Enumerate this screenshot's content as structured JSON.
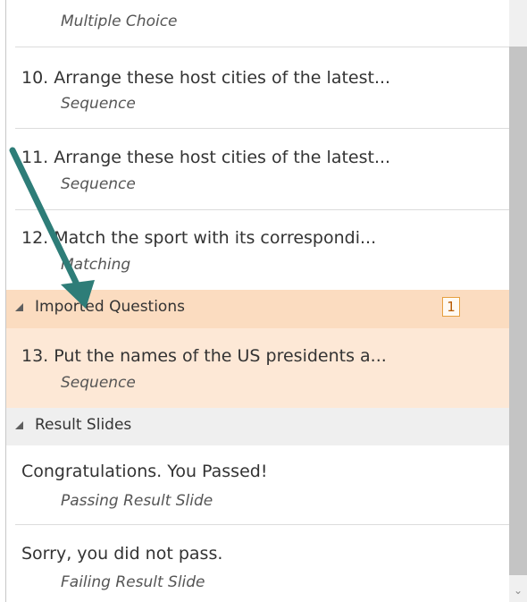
{
  "items_top": {
    "subtitle": "Multiple Choice"
  },
  "questions": [
    {
      "title": "10. Arrange these host cities of the latest...",
      "type": "Sequence"
    },
    {
      "title": "11. Arrange these host cities of the latest...",
      "type": "Sequence"
    },
    {
      "title": "12.  Match the sport with its correspondi...",
      "type": "Matching"
    }
  ],
  "imported_group": {
    "label": "Imported Questions",
    "count": "1",
    "items": [
      {
        "title": "13. Put the names of the US presidents a...",
        "type": "Sequence"
      }
    ]
  },
  "result_group": {
    "label": "Result Slides",
    "items": [
      {
        "title": "Congratulations. You Passed!",
        "type": "Passing Result Slide"
      },
      {
        "title": "Sorry, you did not pass.",
        "type": "Failing Result Slide"
      }
    ]
  },
  "colors": {
    "imported_bg": "#fbdcc0",
    "selected_bg": "#fde8d6",
    "result_header_bg": "#efefef",
    "arrow": "#2e7d78"
  },
  "icons": {
    "expand": "collapse-triangle-icon",
    "scroll_down": "chevron-down-icon"
  }
}
